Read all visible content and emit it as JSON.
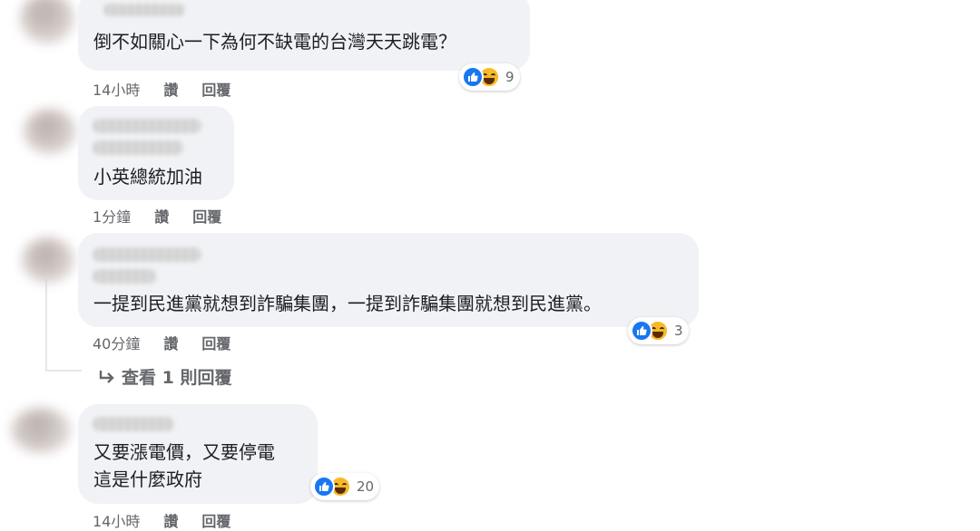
{
  "comments": [
    {
      "text_lines": [
        "倒不如關心一下為何不缺電的台灣天天跳電？"
      ],
      "reaction_count": "9",
      "time": "14小時",
      "like_label": "讚",
      "reply_label": "回覆"
    },
    {
      "text_lines": [
        "小英總統加油"
      ],
      "time": "1分鐘",
      "like_label": "讚",
      "reply_label": "回覆"
    },
    {
      "text_lines": [
        "一提到民進黨就想到詐騙集團，一提到詐騙集團就想到民進黨。"
      ],
      "reaction_count": "3",
      "time": "40分鐘",
      "like_label": "讚",
      "reply_label": "回覆",
      "view_replies": "查看 1 則回覆"
    },
    {
      "text_lines": [
        "又要漲電價，又要停電",
        "這是什麼政府"
      ],
      "reaction_count": "20",
      "time": "14小時",
      "like_label": "讚",
      "reply_label": "回覆"
    }
  ],
  "icons": {
    "like": "thumbs-up-icon",
    "haha": "laughing-face-icon",
    "reply_arrow": "reply-arrow-icon"
  },
  "colors": {
    "bubble": "#f0f2f5",
    "like_blue": "#1877f2",
    "haha_yellow": "#f7b928",
    "meta_gray": "#65676b"
  }
}
